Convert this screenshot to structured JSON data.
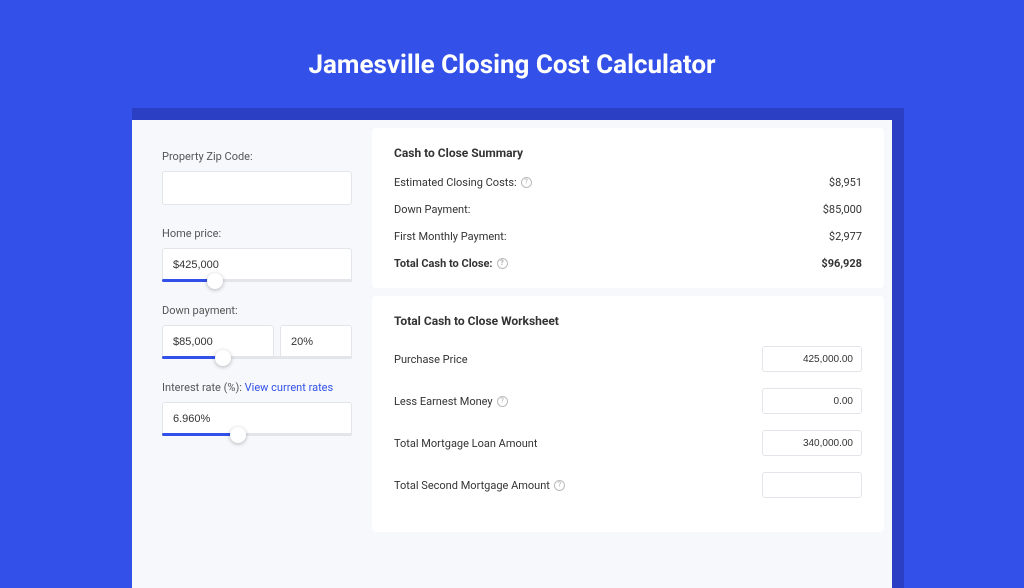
{
  "title": "Jamesville Closing Cost Calculator",
  "left": {
    "zip_label": "Property Zip Code:",
    "zip_value": "",
    "price_label": "Home price:",
    "price_value": "$425,000",
    "down_label": "Down payment:",
    "down_amount": "$85,000",
    "down_percent": "20%",
    "rate_label": "Interest rate (%): ",
    "rate_link": "View current rates",
    "rate_value": "6.960%"
  },
  "summary": {
    "title": "Cash to Close Summary",
    "rows": [
      {
        "label": "Estimated Closing Costs:",
        "help": true,
        "value": "$8,951"
      },
      {
        "label": "Down Payment:",
        "help": false,
        "value": "$85,000"
      },
      {
        "label": "First Monthly Payment:",
        "help": false,
        "value": "$2,977"
      }
    ],
    "total": {
      "label": "Total Cash to Close:",
      "help": true,
      "value": "$96,928"
    }
  },
  "worksheet": {
    "title": "Total Cash to Close Worksheet",
    "rows": [
      {
        "label": "Purchase Price",
        "help": false,
        "value": "425,000.00"
      },
      {
        "label": "Less Earnest Money",
        "help": true,
        "value": "0.00"
      },
      {
        "label": "Total Mortgage Loan Amount",
        "help": false,
        "value": "340,000.00"
      },
      {
        "label": "Total Second Mortgage Amount",
        "help": true,
        "value": ""
      }
    ]
  },
  "sliders": {
    "price_fill_pct": 28,
    "down_fill_pct": 32,
    "rate_fill_pct": 40
  }
}
